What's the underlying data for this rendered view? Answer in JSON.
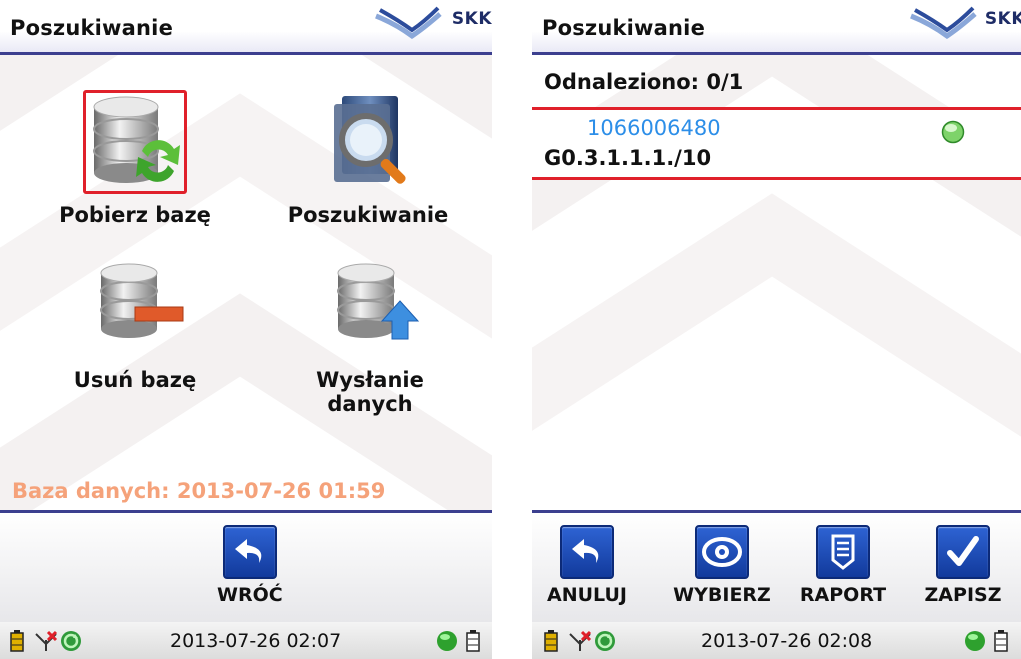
{
  "left": {
    "title": "Poszukiwanie",
    "logo_text": "SKK",
    "tiles": [
      {
        "label": "Pobierz bazę",
        "icon": "db-download-icon",
        "selected": true
      },
      {
        "label": "Poszukiwanie",
        "icon": "magnifier-search-icon",
        "selected": false
      },
      {
        "label": "Usuń bazę",
        "icon": "db-delete-icon",
        "selected": false
      },
      {
        "label": "Wysłanie danych",
        "icon": "db-upload-icon",
        "selected": false
      }
    ],
    "db_status": "Baza danych: 2013-07-26 01:59",
    "back_label": "WRÓĆ",
    "time": "2013-07-26 02:07"
  },
  "right": {
    "title": "Poszukiwanie",
    "logo_text": "SKK",
    "found": "Odnaleziono: 0/1",
    "result": {
      "code": "1066006480",
      "path": "G0.3.1.1.1./10",
      "status_color": "#7ed36a"
    },
    "buttons": [
      {
        "label": "ANULUJ",
        "icon": "undo-icon"
      },
      {
        "label": "WYBIERZ",
        "icon": "eye-icon"
      },
      {
        "label": "RAPORT",
        "icon": "report-icon"
      },
      {
        "label": "ZAPISZ",
        "icon": "check-icon"
      }
    ],
    "time": "2013-07-26 02:08"
  },
  "colors": {
    "accent": "#3c3f8f",
    "selection": "#e0202a",
    "status_text": "#f5a27a",
    "link": "#2c8ee8",
    "button": "#1f4fbf"
  }
}
